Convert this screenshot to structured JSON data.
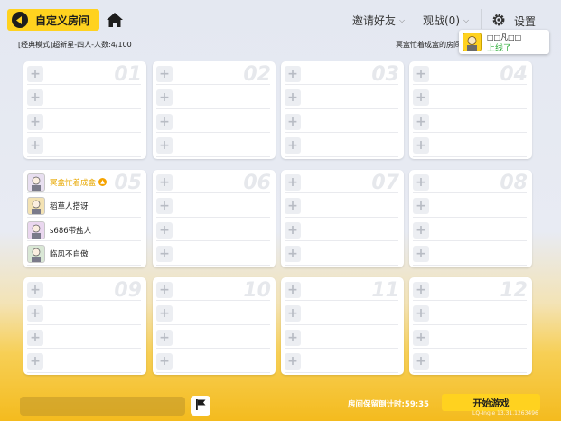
{
  "header": {
    "title": "自定义房间",
    "invite_label": "邀请好友",
    "spectate_label": "观战(0)",
    "settings_label": "设置"
  },
  "room": {
    "info": "[经典模式]超新星-四人-人数:4/100",
    "owner_room": "冥盒忙着成盒的房间"
  },
  "notification": {
    "name": "□□凡□□",
    "status": "上线了"
  },
  "teams": [
    {
      "number": "01",
      "players": []
    },
    {
      "number": "02",
      "players": []
    },
    {
      "number": "03",
      "players": []
    },
    {
      "number": "04",
      "players": []
    },
    {
      "number": "05",
      "players": [
        "冥盒忙着成盒",
        "稻草人搭讶",
        "s686带盐人",
        "临风不自傲"
      ]
    },
    {
      "number": "06",
      "players": []
    },
    {
      "number": "07",
      "players": []
    },
    {
      "number": "08",
      "players": []
    },
    {
      "number": "09",
      "players": []
    },
    {
      "number": "10",
      "players": []
    },
    {
      "number": "11",
      "players": []
    },
    {
      "number": "12",
      "players": []
    }
  ],
  "footer": {
    "countdown": "房间保留倒计时:59:35",
    "start_label": "开始游戏",
    "version": "LQ-Ingle 13.31.1263496"
  },
  "colors": {
    "accent": "#ffd21f",
    "owner_name": "#e8a800",
    "online": "#2fae3a"
  }
}
